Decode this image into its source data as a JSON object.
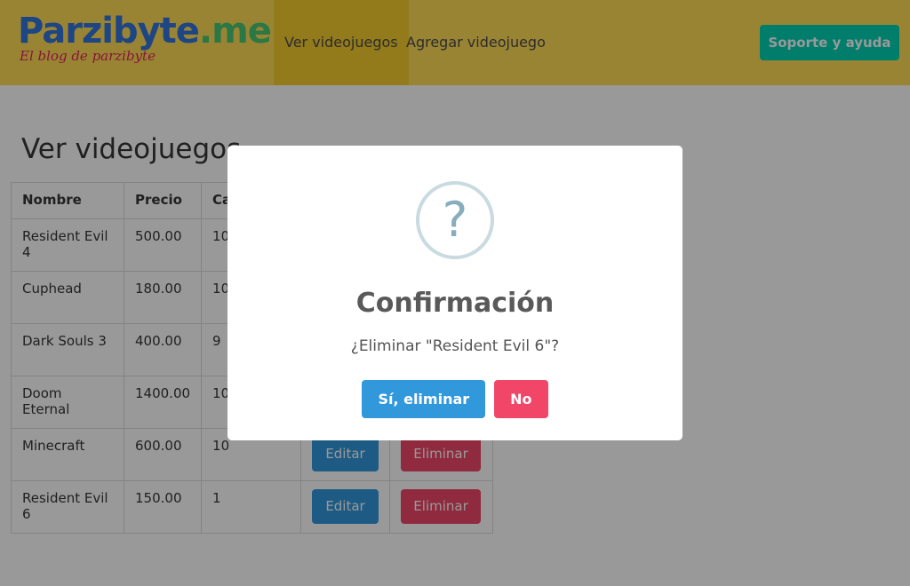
{
  "brand": {
    "title_part1": "Parzibyte",
    "title_part2": ".me",
    "subtitle": "El blog de parzibyte"
  },
  "nav": {
    "items": [
      {
        "label": "Ver videojuegos",
        "active": true
      },
      {
        "label": "Agregar videojuego",
        "active": false
      }
    ],
    "support_label": "Soporte y ayuda"
  },
  "page": {
    "title": "Ver videojuegos"
  },
  "table": {
    "headers": [
      "Nombre",
      "Precio",
      "Cal"
    ],
    "edit_label": "Editar",
    "delete_label": "Eliminar",
    "rows": [
      {
        "name": "Resident Evil 4",
        "price": "500.00",
        "rating": "10"
      },
      {
        "name": "Cuphead",
        "price": "180.00",
        "rating": "10"
      },
      {
        "name": "Dark Souls 3",
        "price": "400.00",
        "rating": "9"
      },
      {
        "name": "Doom Eternal",
        "price": "1400.00",
        "rating": "10"
      },
      {
        "name": "Minecraft",
        "price": "600.00",
        "rating": "10"
      },
      {
        "name": "Resident Evil 6",
        "price": "150.00",
        "rating": "1"
      }
    ]
  },
  "modal": {
    "icon": "question-icon",
    "icon_glyph": "?",
    "title": "Confirmación",
    "message": "¿Eliminar \"Resident Evil 6\"?",
    "confirm_label": "Sí, eliminar",
    "cancel_label": "No"
  },
  "colors": {
    "navbar": "#ffdd57",
    "primary": "#3298dc",
    "danger": "#f14668",
    "support": "#00d1b2"
  }
}
